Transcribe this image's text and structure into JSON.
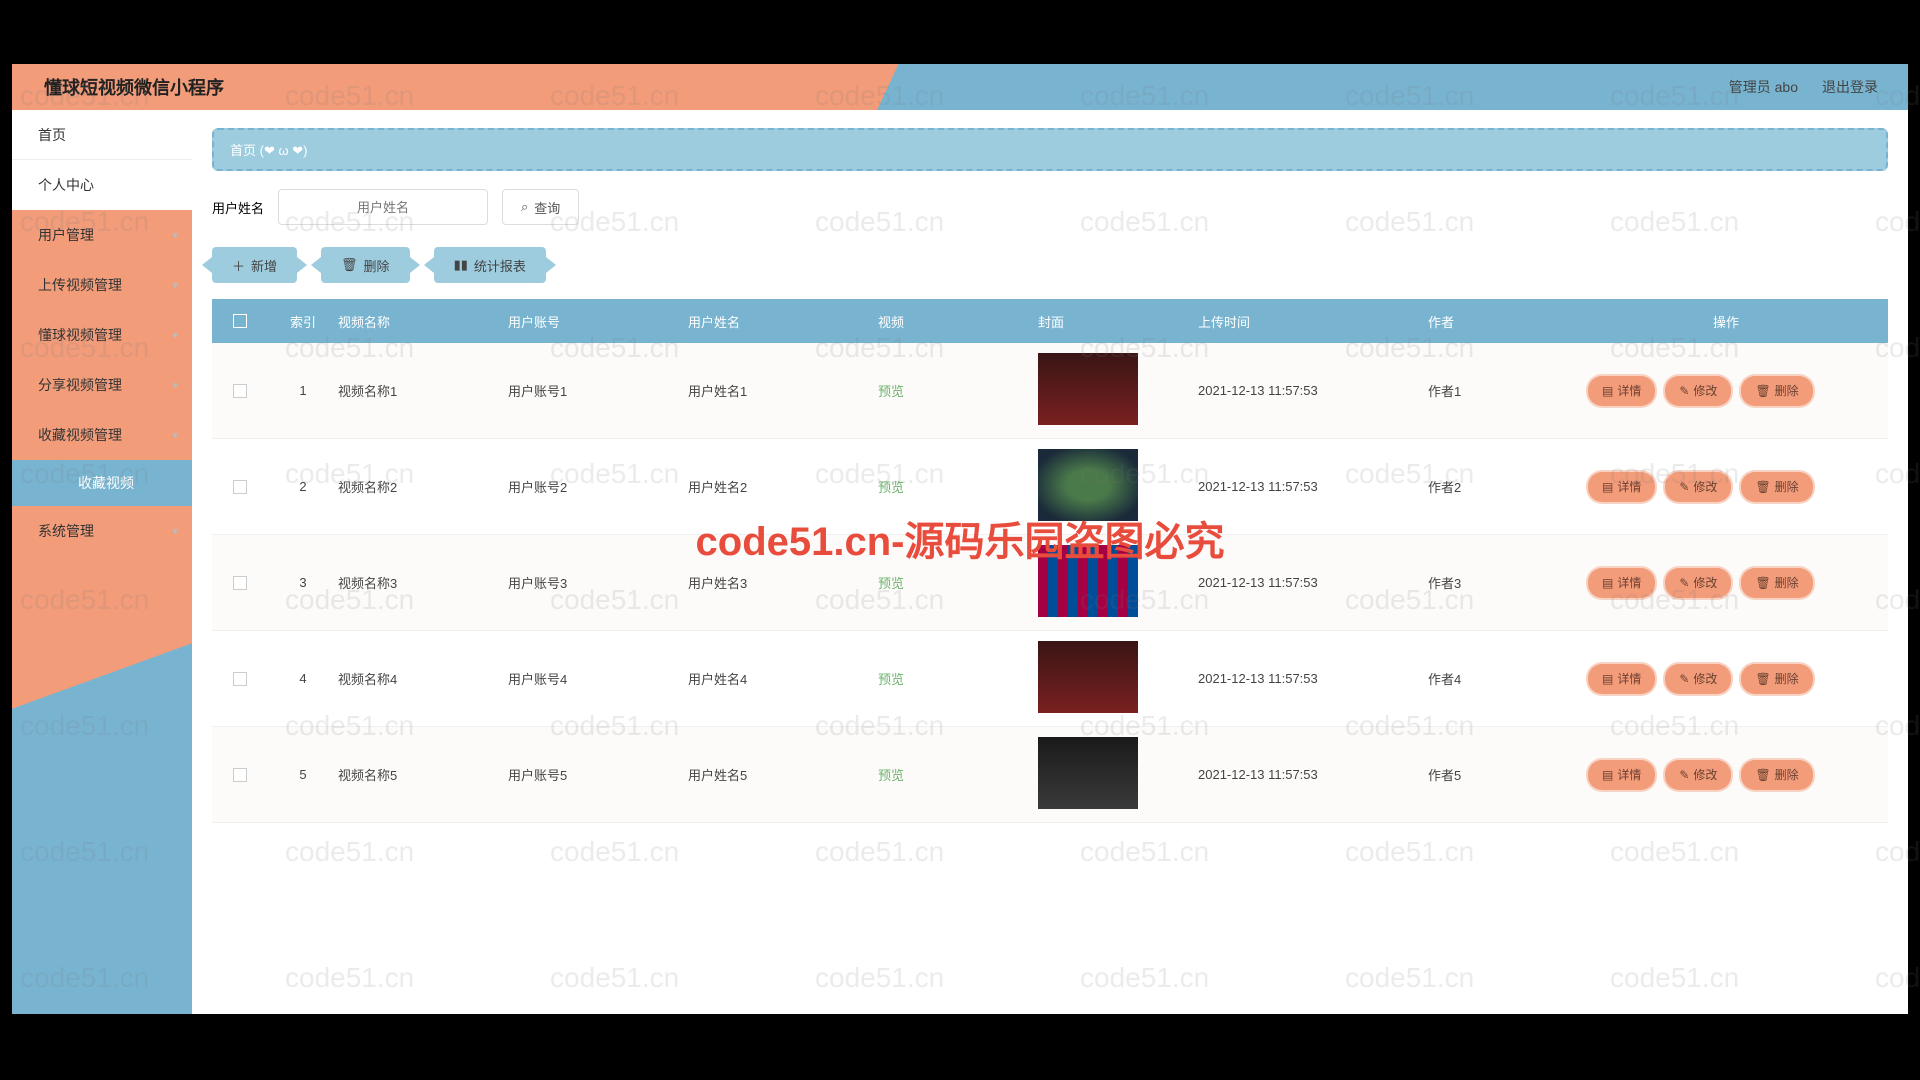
{
  "header": {
    "title": "懂球短视频微信小程序",
    "admin": "管理员 abo",
    "logout": "退出登录"
  },
  "sidebar": {
    "items": [
      {
        "label": "首页",
        "light": true
      },
      {
        "label": "个人中心",
        "light": true
      },
      {
        "label": "用户管理",
        "chev": true
      },
      {
        "label": "上传视频管理",
        "chev": true
      },
      {
        "label": "懂球视频管理",
        "chev": true
      },
      {
        "label": "分享视频管理",
        "chev": true
      },
      {
        "label": "收藏视频管理",
        "chev": true
      },
      {
        "label": "系统管理",
        "chev": true
      }
    ],
    "sub": {
      "label": "收藏视频"
    }
  },
  "crumb": {
    "home": "首页",
    "decor": "(❤ ω ❤)"
  },
  "search": {
    "label": "用户姓名",
    "placeholder": "用户姓名",
    "query": "查询"
  },
  "toolbar": {
    "add": "新增",
    "delete": "删除",
    "report": "统计报表"
  },
  "table": {
    "cols": {
      "idx": "索引",
      "name": "视频名称",
      "acct": "用户账号",
      "uname": "用户姓名",
      "video": "视频",
      "cover": "封面",
      "time": "上传时间",
      "author": "作者",
      "ops": "操作"
    },
    "preview": "预览",
    "ops": {
      "detail": "详情",
      "edit": "修改",
      "delete": "删除"
    },
    "rows": [
      {
        "idx": "1",
        "name": "视频名称1",
        "acct": "用户账号1",
        "uname": "用户姓名1",
        "time": "2021-12-13 11:57:53",
        "author": "作者1",
        "thumb": "crowd"
      },
      {
        "idx": "2",
        "name": "视频名称2",
        "acct": "用户账号2",
        "uname": "用户姓名2",
        "time": "2021-12-13 11:57:53",
        "author": "作者2",
        "thumb": "stadium"
      },
      {
        "idx": "3",
        "name": "视频名称3",
        "acct": "用户账号3",
        "uname": "用户姓名3",
        "time": "2021-12-13 11:57:53",
        "author": "作者3",
        "thumb": "barca"
      },
      {
        "idx": "4",
        "name": "视频名称4",
        "acct": "用户账号4",
        "uname": "用户姓名4",
        "time": "2021-12-13 11:57:53",
        "author": "作者4",
        "thumb": "crowd"
      },
      {
        "idx": "5",
        "name": "视频名称5",
        "acct": "用户账号5",
        "uname": "用户姓名5",
        "time": "2021-12-13 11:57:53",
        "author": "作者5",
        "thumb": "player"
      }
    ]
  },
  "watermark": {
    "text": "code51.cn",
    "center": "code51.cn-源码乐园盗图必究"
  }
}
